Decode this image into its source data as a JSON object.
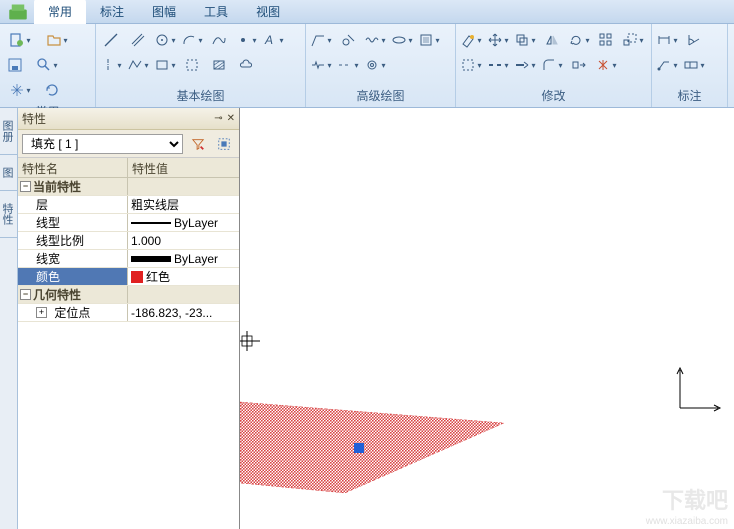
{
  "ribbon": {
    "tabs": [
      "常用",
      "标注",
      "图幅",
      "工具",
      "视图"
    ],
    "groups": {
      "g1": "常用",
      "g2": "基本绘图",
      "g3": "高级绘图",
      "g4": "修改",
      "g5": "标注"
    }
  },
  "dock": {
    "t1": "图册",
    "t2": "图",
    "t3": "特性"
  },
  "panel": {
    "title": "特性",
    "selection": "填充 [ 1 ]",
    "headerName": "特性名",
    "headerValue": "特性值"
  },
  "props": {
    "currentGroup": "当前特性",
    "layer": {
      "name": "层",
      "value": "粗实线层"
    },
    "linetype": {
      "name": "线型",
      "value": "ByLayer"
    },
    "ltscale": {
      "name": "线型比例",
      "value": "1.000"
    },
    "lineweight": {
      "name": "线宽",
      "value": "ByLayer"
    },
    "color": {
      "name": "颜色",
      "value": "红色",
      "hex": "#e02020"
    },
    "geomGroup": "几何特性",
    "anchor": {
      "name": "定位点",
      "value": "-186.823, -23..."
    }
  },
  "watermark": {
    "text": "www.xiazaiba.com",
    "logo": "下载吧"
  }
}
